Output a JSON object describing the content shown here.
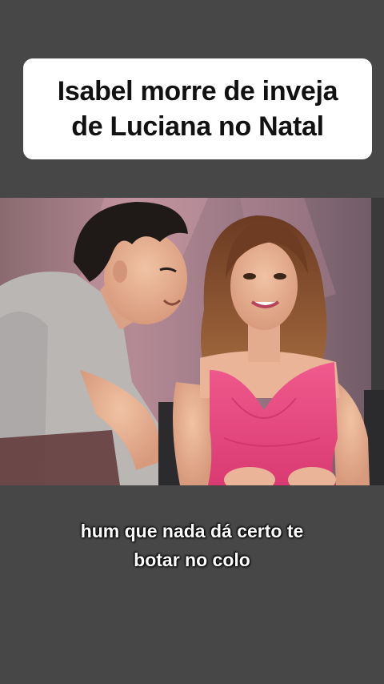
{
  "title": {
    "line1": "Isabel morre de inveja",
    "line2": "de Luciana no Natal"
  },
  "caption": {
    "line1": "hum que nada dá certo te",
    "line2": "botar no colo"
  },
  "colors": {
    "background": "#474747",
    "card": "#ffffff",
    "title_text": "#111111",
    "caption_text": "#ffffff",
    "dress": "#e8457d"
  }
}
